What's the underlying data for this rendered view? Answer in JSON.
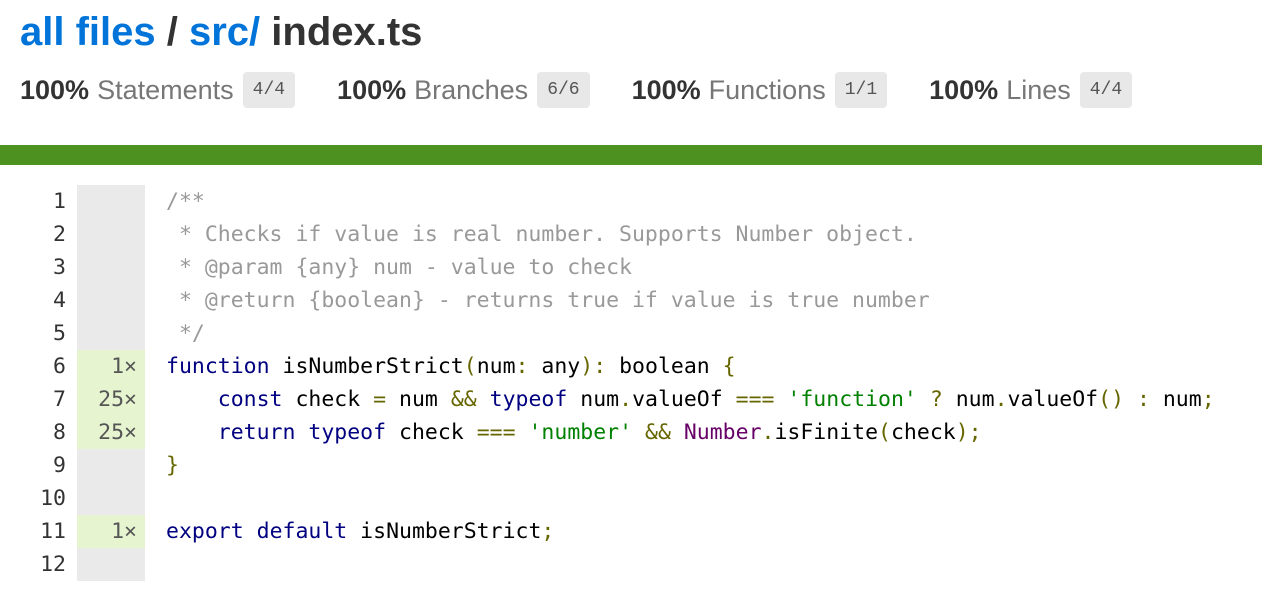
{
  "breadcrumb": {
    "all_files": "all files",
    "sep1": " / ",
    "src": "src/",
    "sep2": " ",
    "file": "index.ts"
  },
  "stats": [
    {
      "pct": "100%",
      "label": "Statements",
      "fraction": "4/4"
    },
    {
      "pct": "100%",
      "label": "Branches",
      "fraction": "6/6"
    },
    {
      "pct": "100%",
      "label": "Functions",
      "fraction": "1/1"
    },
    {
      "pct": "100%",
      "label": "Lines",
      "fraction": "4/4"
    }
  ],
  "colors": {
    "link": "#0074D9",
    "coverage_bar": "#4d9221",
    "hit_bg": "#e6f5d0",
    "neutral_bg": "#eaeaea"
  },
  "lines": [
    {
      "n": "1",
      "hits": ""
    },
    {
      "n": "2",
      "hits": ""
    },
    {
      "n": "3",
      "hits": ""
    },
    {
      "n": "4",
      "hits": ""
    },
    {
      "n": "5",
      "hits": ""
    },
    {
      "n": "6",
      "hits": "1×"
    },
    {
      "n": "7",
      "hits": "25×"
    },
    {
      "n": "8",
      "hits": "25×"
    },
    {
      "n": "9",
      "hits": ""
    },
    {
      "n": "10",
      "hits": ""
    },
    {
      "n": "11",
      "hits": "1×"
    },
    {
      "n": "12",
      "hits": ""
    }
  ],
  "code": {
    "l1": "/**",
    "l2": " * Checks if value is real number. Supports Number object.",
    "l3": " * @param {any} num - value to check",
    "l4": " * @return {boolean} - returns true if value is true number",
    "l5": " */",
    "l6": {
      "kw": "function",
      "name": " isNumberStrict",
      "p1": "(",
      "arg": "num",
      "c": ": ",
      "t": "any",
      "p2": "): ",
      "ret": "boolean",
      "b": " {"
    },
    "l7": {
      "ind": "    ",
      "kw": "const",
      "a": " check ",
      "eq": "=",
      "b": " num ",
      "and": "&&",
      "sp": " ",
      "typeof": "typeof",
      "c": " num",
      "dot": ".",
      "m": "valueOf",
      "s1": " ",
      "op3": "===",
      "s2": " ",
      "str": "'function'",
      "s3": " ",
      "q": "?",
      "d": " num",
      "dot2": ".",
      "m2": "valueOf",
      "pp": "()",
      "s4": " ",
      "col": ":",
      "e": " num",
      "semi": ";"
    },
    "l8": {
      "ind": "    ",
      "kw": "return",
      "s": " ",
      "typeof": "typeof",
      "a": " check ",
      "op3": "===",
      "s2": " ",
      "str": "'number'",
      "s3": " ",
      "and": "&&",
      "s4": " ",
      "cls": "Number",
      "dot": ".",
      "m": "isFinite",
      "p1": "(",
      "arg": "check",
      "p2": ");"
    },
    "l9": "}",
    "l10": "",
    "l11": {
      "kw1": "export",
      "s": " ",
      "kw2": "default",
      "name": " isNumberStrict",
      "semi": ";"
    },
    "l12": ""
  }
}
